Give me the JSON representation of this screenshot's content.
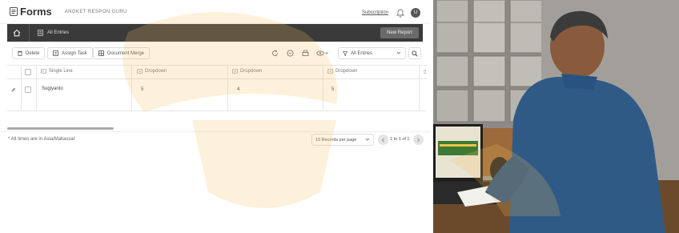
{
  "header": {
    "app_name": "Forms",
    "form_name": "ANGKET RESPON GURU",
    "subscription": "Subscription",
    "avatar_initial": "U"
  },
  "nav": {
    "all_entries": "All Entries",
    "new_report": "New Report"
  },
  "toolbar": {
    "delete": "Delete",
    "assign_task": "Assign Task",
    "document_merge": "Document Merge",
    "view_selected": "All Entries"
  },
  "table": {
    "columns": [
      "Single Line",
      "Dropdown",
      "Dropdown",
      "Dropdown"
    ],
    "rows": [
      {
        "single_line": "Sugiyanto",
        "dropdown_1": "5",
        "dropdown_2": "4",
        "dropdown_3": "5"
      }
    ]
  },
  "footer": {
    "timezone_note": "* All times are in Asia/Makassar",
    "records_per_page": "10 Records per page",
    "page_info": "1 to 1 of 1"
  },
  "colors": {
    "nav_bg": "#3a3a3a",
    "watermark": "#f5c15a",
    "shirt": "#2f5a86",
    "wall": "#9a9690"
  },
  "photo": {
    "icons": [
      "person-photo"
    ]
  }
}
